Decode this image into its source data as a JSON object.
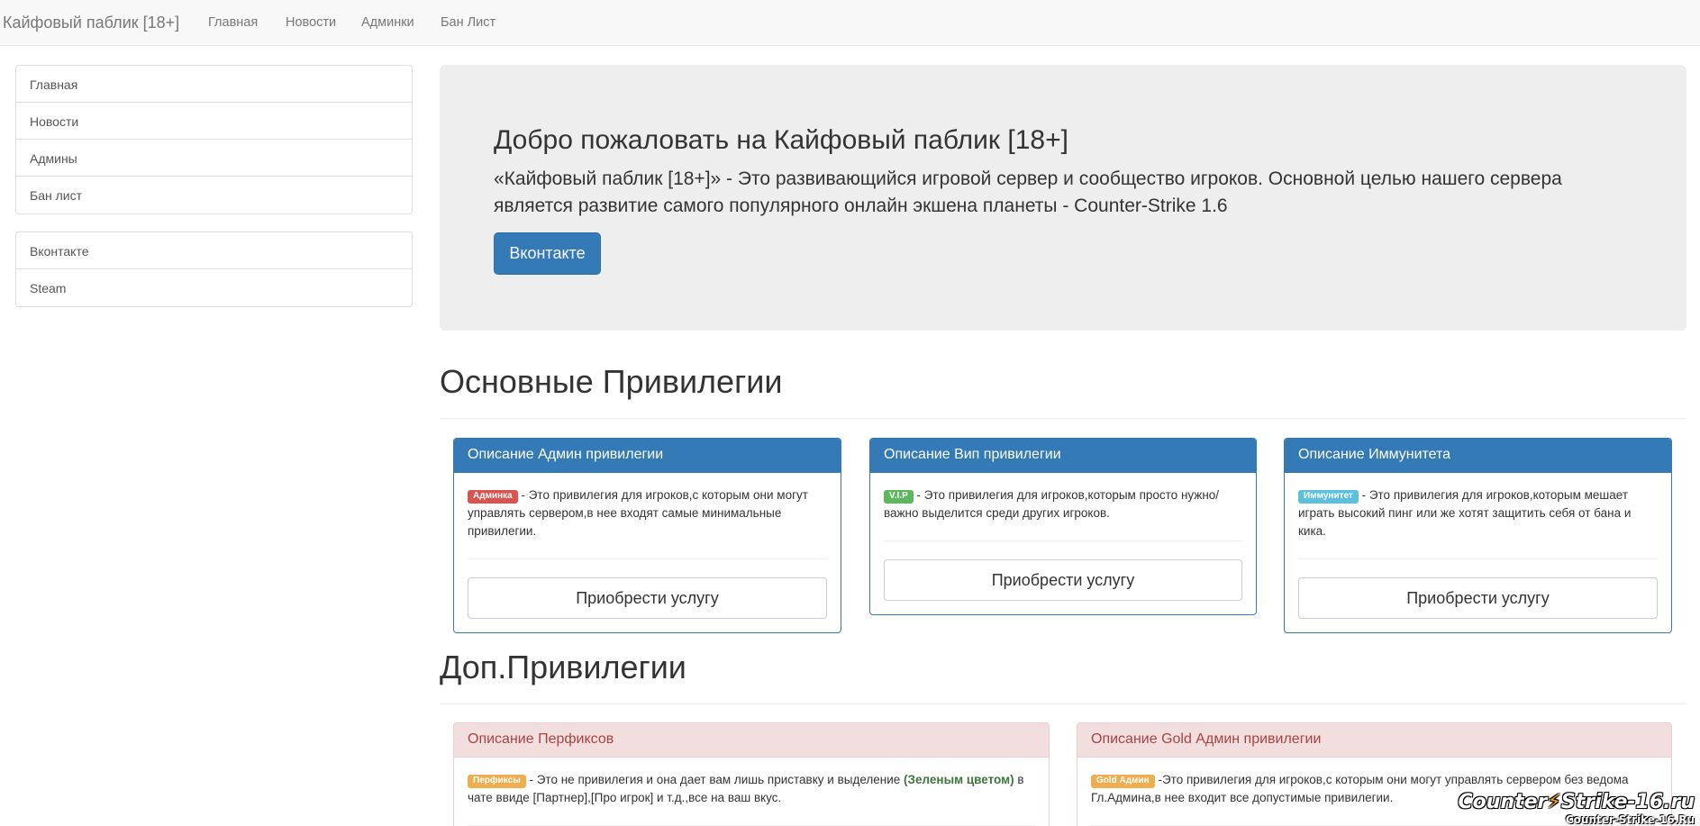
{
  "navbar": {
    "brand": "Кайфовый паблик [18+]",
    "links": [
      "Главная",
      "Новости",
      "Админки",
      "Бан Лист"
    ]
  },
  "sidebar": {
    "menu": [
      "Главная",
      "Новости",
      "Админы",
      "Бан лист"
    ],
    "social": [
      "Вконтакте",
      "Steam"
    ]
  },
  "jumbotron": {
    "title": "Добро пожаловать на Кайфовый паблик [18+]",
    "text": "«Кайфовый паблик [18+]» - Это развивающийся игровой сервер и сообщество игроков. Основной целью нашего сервера является развитие самого популярного онлайн экшена планеты - Counter-Strike 1.6",
    "button": "Вконтакте"
  },
  "main_privileges": {
    "heading": "Основные Привилегии",
    "panels": [
      {
        "title": "Описание Админ привилегии",
        "badge": "Админка",
        "text": " - Это привилегия для игроков,с которым они могут управлять сервером,в нее входят самые минимальные привилегии.",
        "button": "Приобрести услугу"
      },
      {
        "title": "Описание Вип привилегии",
        "badge": "V.I.P",
        "text": " - Это привилегия для игроков,которым просто нужно/важно выделится среди других игроков.",
        "button": "Приобрести услугу"
      },
      {
        "title": "Описание Иммунитета",
        "badge": "Иммунитет",
        "text": " - Это привилегия для игроков,которым мешает играть высокий пинг или же хотят защитить себя от бана и кика.",
        "button": "Приобрести услугу"
      }
    ]
  },
  "extra_privileges": {
    "heading": "Доп.Привилегии",
    "panels": [
      {
        "title": "Описание Перфиксов",
        "badge": "Перфиксы",
        "text_before": " - Это не привилегия и она дает вам лишь приставку и выделение ",
        "text_highlight": "(Зеленым цветом)",
        "text_after": " в чате ввиде [Партнер],[Про игрок] и т.д.,все на ваш вкус."
      },
      {
        "title": "Описание Gold Админ привилегии",
        "badge": "Gold Админ",
        "text": " -Это привилегия для игроков,с которым они могут управлять сервером без ведома Гл.Админа,в нее входит все допустимые привилегии."
      }
    ]
  },
  "watermark": {
    "logo_a": "Counter",
    "logo_b": "Strike-16.ru",
    "sub": "Counter-Strike-16.Ru"
  },
  "colors": {
    "primary": "#337ab7",
    "danger_bg": "#f2dede",
    "danger_text": "#a94442",
    "label_danger": "#d9534f",
    "label_success": "#5cb85c",
    "label_info": "#5bc0de",
    "label_warning": "#f0ad4e"
  }
}
